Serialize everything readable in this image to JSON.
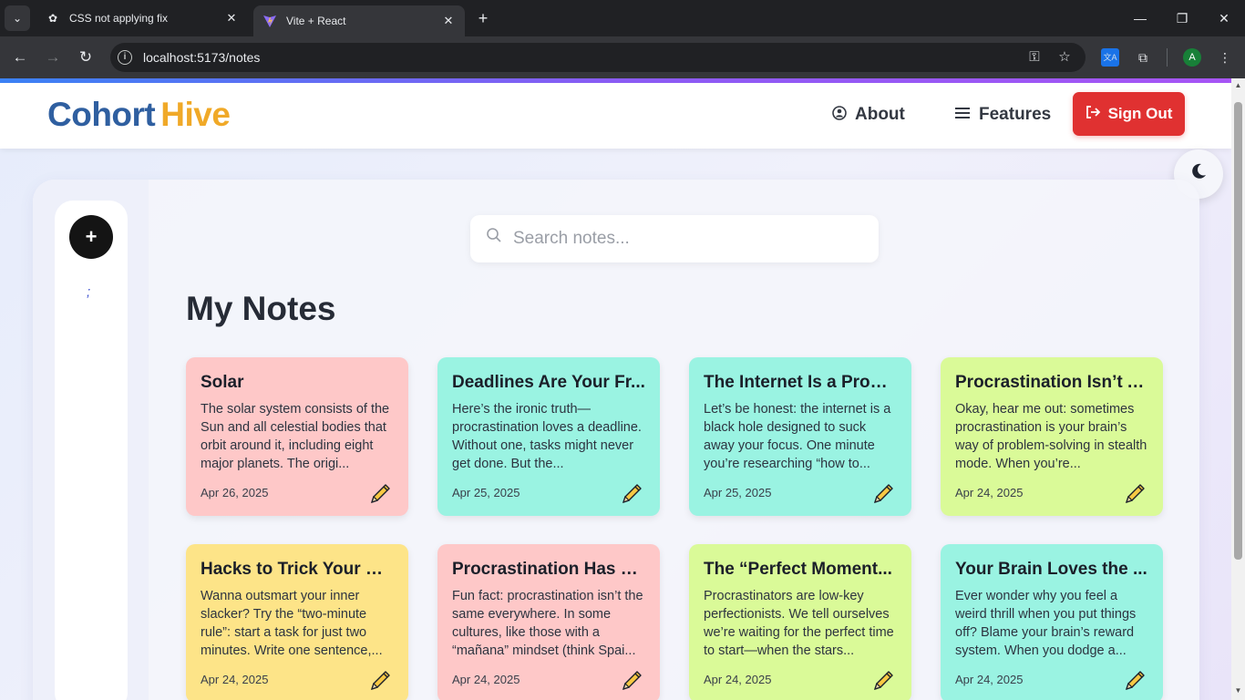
{
  "browser": {
    "tabs": [
      {
        "title": "CSS not applying fix",
        "favicon": "openai-icon"
      },
      {
        "title": "Vite + React",
        "favicon": "vite-icon",
        "active": true
      }
    ],
    "address": "localhost:5173/notes",
    "profile_initial": "A"
  },
  "header": {
    "brand_first": "Cohort",
    "brand_second": "Hive",
    "nav": {
      "about": "About",
      "features": "Features",
      "sign_out": "Sign Out"
    }
  },
  "sidebar": {
    "add_label": "+",
    "mark": ";"
  },
  "search": {
    "placeholder": "Search notes..."
  },
  "page_title": "My Notes",
  "notes": [
    {
      "title": "Solar",
      "body": "The solar system consists of the Sun and all celestial bodies that orbit around it, including eight major planets. The origi...",
      "date": "Apr 26, 2025",
      "color": "#fec8c8"
    },
    {
      "title": "Deadlines Are Your Fr...",
      "body": "Here’s the ironic truth—procrastination loves a deadline. Without one, tasks might never get done. But the...",
      "date": "Apr 25, 2025",
      "color": "#9af3e2"
    },
    {
      "title": "The Internet Is a Procr...",
      "body": "Let’s be honest: the internet is a black hole designed to suck away your focus. One minute you’re researching “how to...",
      "date": "Apr 25, 2025",
      "color": "#9af3e2"
    },
    {
      "title": "Procrastination Isn’t A...",
      "body": "Okay, hear me out: sometimes procrastination is your brain’s way of problem-solving in stealth mode. When you’re...",
      "date": "Apr 24, 2025",
      "color": "#dafa98"
    },
    {
      "title": "Hacks to Trick Your Pr...",
      "body": "Wanna outsmart your inner slacker? Try the “two-minute rule”: start a task for just two minutes. Write one sentence,...",
      "date": "Apr 24, 2025",
      "color": "#fde488"
    },
    {
      "title": "Procrastination Has a ...",
      "body": "Fun fact: procrastination isn’t the same everywhere. In some cultures, like those with a “mañana” mindset (think Spai...",
      "date": "Apr 24, 2025",
      "color": "#fec8c8"
    },
    {
      "title": "The “Perfect Moment...",
      "body": "Procrastinators are low-key perfectionists. We tell ourselves we’re waiting for the perfect time to start—when the stars...",
      "date": "Apr 24, 2025",
      "color": "#dafa98"
    },
    {
      "title": "Your Brain Loves the ...",
      "body": "Ever wonder why you feel a weird thrill when you put things off? Blame your brain’s reward system. When you dodge a...",
      "date": "Apr 24, 2025",
      "color": "#9af3e2"
    }
  ]
}
